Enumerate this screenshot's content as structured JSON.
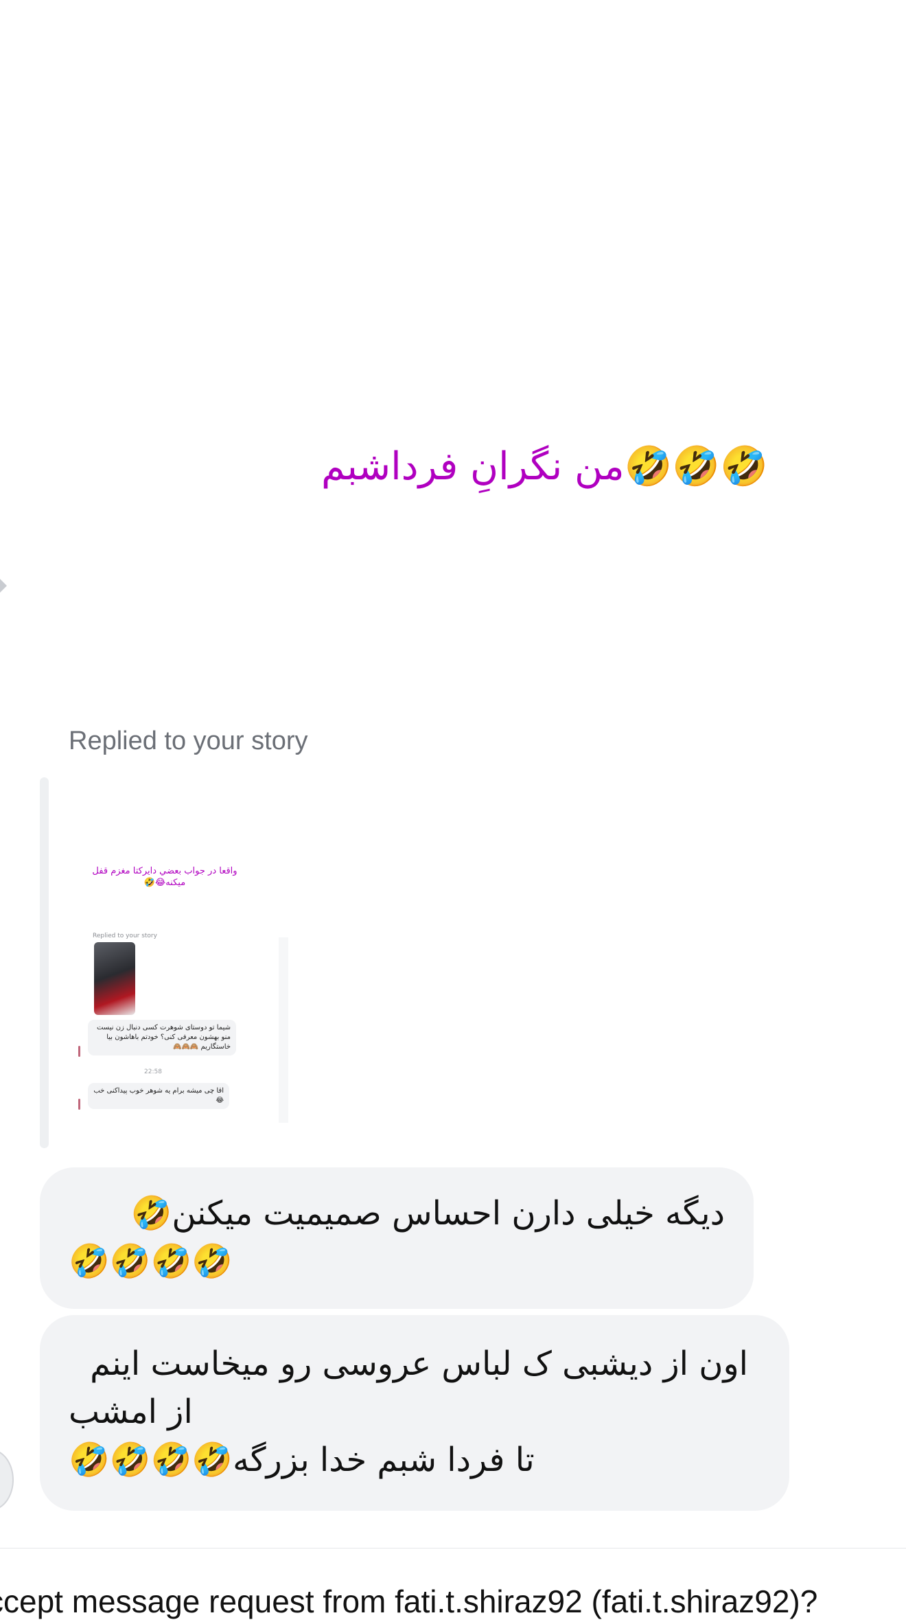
{
  "story": {
    "caption": "من نگرانِ فرداشبم🤣🤣🤣"
  },
  "reply": {
    "label": "Replied to your story",
    "thumbnail": {
      "caption": "واقعا در جواب بعضي دایرکتا مغزم قفل میکنه😂🤣",
      "reply_label": "Replied to your story",
      "message_1": "شیما تو دوستای شوهرت کسی دنبال زن نیست منو بهشون معرفی کنی؟ خودتم باهاشون بیا خاستگاریم 🙈🙈🙈",
      "time": "22:58",
      "message_2": "اقا چی میشه برام یه شوهر خوب پیداکنی خب 😂"
    }
  },
  "messages": [
    {
      "lines": [
        "دیگه خیلی دارن احساس صمیمیت میکنن🤣",
        "🤣🤣🤣🤣"
      ]
    },
    {
      "lines": [
        "اون از دیشبی ک لباس عروسی رو میخاست اینم",
        "از امشب",
        "تا فردا شبم خدا بزرگه🤣🤣🤣🤣"
      ]
    }
  ],
  "request": {
    "text": "ccept message request from fati.t.shiraz92 (fati.t.shiraz92)?"
  },
  "colors": {
    "caption": "#b000c0",
    "bubble": "#f2f3f5",
    "muted_text": "#6b6f76"
  },
  "icons": [
    "partial-avatar",
    "left-edge-indicator"
  ]
}
